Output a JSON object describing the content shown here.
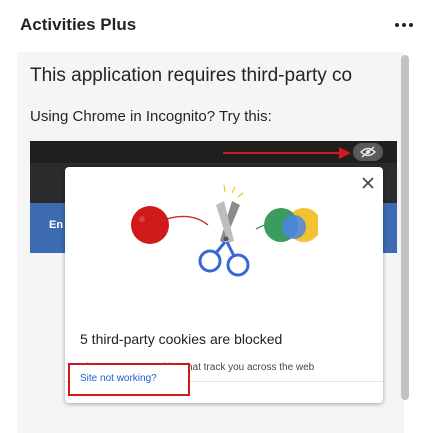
{
  "header": {
    "title": "Activities Plus",
    "more_icon": "more-horizontal-icon"
  },
  "main": {
    "heading": "This application requires third-party co",
    "subtext": "Using Chrome in Incognito? Try this:"
  },
  "screenshot": {
    "blue_band_text": "En",
    "eye_icon": "eye-off-icon",
    "arrow_icon": "arrow-right-icon",
    "popup": {
      "close_icon": "close-icon",
      "illustration_icon": "scissors-cookie-icon",
      "title": "5 third-party cookies are blocked",
      "description": "Sites can't use cookies that track you across the web",
      "link_label": "Site not working?"
    }
  },
  "colors": {
    "highlight_red": "#d0191b",
    "link_blue": "#1a5fd1",
    "panel_bg": "#f5f5f5"
  }
}
